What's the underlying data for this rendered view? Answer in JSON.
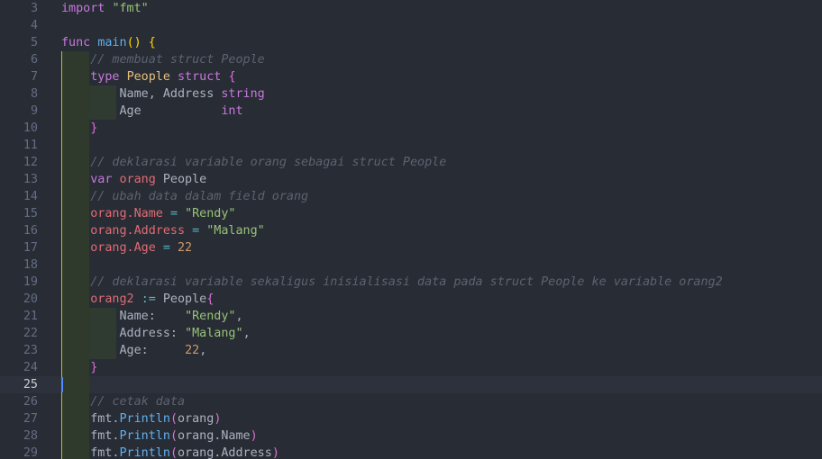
{
  "editor": {
    "current_line": 25,
    "lines": [
      {
        "no": "3",
        "tokens": [
          [
            "kw",
            "import"
          ],
          [
            "pl",
            " "
          ],
          [
            "str",
            "\"fmt\""
          ]
        ]
      },
      {
        "no": "4",
        "tokens": []
      },
      {
        "no": "5",
        "tokens": [
          [
            "kw",
            "func"
          ],
          [
            "pl",
            " "
          ],
          [
            "fn",
            "main"
          ],
          [
            "br1",
            "()"
          ],
          [
            "pl",
            " "
          ],
          [
            "br1",
            "{"
          ]
        ]
      },
      {
        "no": "6",
        "tokens": [
          [
            "cmt",
            "// membuat struct People"
          ]
        ]
      },
      {
        "no": "7",
        "tokens": [
          [
            "kw",
            "type"
          ],
          [
            "pl",
            " "
          ],
          [
            "typ",
            "People"
          ],
          [
            "pl",
            " "
          ],
          [
            "kw",
            "struct"
          ],
          [
            "pl",
            " "
          ],
          [
            "br2",
            "{"
          ]
        ]
      },
      {
        "no": "8",
        "tokens": [
          [
            "pl",
            "    Name, Address "
          ],
          [
            "kw",
            "string"
          ]
        ]
      },
      {
        "no": "9",
        "tokens": [
          [
            "pl",
            "    Age           "
          ],
          [
            "kw",
            "int"
          ]
        ]
      },
      {
        "no": "10",
        "tokens": [
          [
            "br2",
            "}"
          ]
        ]
      },
      {
        "no": "11",
        "tokens": []
      },
      {
        "no": "12",
        "tokens": [
          [
            "cmt",
            "// deklarasi variable orang sebagai struct People"
          ]
        ]
      },
      {
        "no": "13",
        "tokens": [
          [
            "kw",
            "var"
          ],
          [
            "pl",
            " "
          ],
          [
            "var",
            "orang"
          ],
          [
            "pl",
            " People"
          ]
        ]
      },
      {
        "no": "14",
        "tokens": [
          [
            "cmt",
            "// ubah data dalam field orang"
          ]
        ]
      },
      {
        "no": "15",
        "tokens": [
          [
            "var",
            "orang.Name"
          ],
          [
            "pl",
            " "
          ],
          [
            "op",
            "="
          ],
          [
            "pl",
            " "
          ],
          [
            "str",
            "\"Rendy\""
          ]
        ]
      },
      {
        "no": "16",
        "tokens": [
          [
            "var",
            "orang.Address"
          ],
          [
            "pl",
            " "
          ],
          [
            "op",
            "="
          ],
          [
            "pl",
            " "
          ],
          [
            "str",
            "\"Malang\""
          ]
        ]
      },
      {
        "no": "17",
        "tokens": [
          [
            "var",
            "orang.Age"
          ],
          [
            "pl",
            " "
          ],
          [
            "op",
            "="
          ],
          [
            "pl",
            " "
          ],
          [
            "num",
            "22"
          ]
        ]
      },
      {
        "no": "18",
        "tokens": []
      },
      {
        "no": "19",
        "tokens": [
          [
            "cmt",
            "// deklarasi variable sekaligus inisialisasi data pada struct People ke variable orang2"
          ]
        ]
      },
      {
        "no": "20",
        "tokens": [
          [
            "var",
            "orang2"
          ],
          [
            "pl",
            " "
          ],
          [
            "op",
            ":="
          ],
          [
            "pl",
            " People"
          ],
          [
            "br2",
            "{"
          ]
        ]
      },
      {
        "no": "21",
        "tokens": [
          [
            "pl",
            "    Name:    "
          ],
          [
            "str",
            "\"Rendy\""
          ],
          [
            "pl",
            ","
          ]
        ]
      },
      {
        "no": "22",
        "tokens": [
          [
            "pl",
            "    Address: "
          ],
          [
            "str",
            "\"Malang\""
          ],
          [
            "pl",
            ","
          ]
        ]
      },
      {
        "no": "23",
        "tokens": [
          [
            "pl",
            "    Age:     "
          ],
          [
            "num",
            "22"
          ],
          [
            "pl",
            ","
          ]
        ]
      },
      {
        "no": "24",
        "tokens": [
          [
            "br2",
            "}"
          ]
        ]
      },
      {
        "no": "25",
        "tokens": []
      },
      {
        "no": "26",
        "tokens": [
          [
            "cmt",
            "// cetak data"
          ]
        ]
      },
      {
        "no": "27",
        "tokens": [
          [
            "pl",
            "fmt."
          ],
          [
            "fn",
            "Println"
          ],
          [
            "br2",
            "("
          ],
          [
            "pl",
            "orang"
          ],
          [
            "br2",
            ")"
          ]
        ]
      },
      {
        "no": "28",
        "tokens": [
          [
            "pl",
            "fmt."
          ],
          [
            "fn",
            "Println"
          ],
          [
            "br2",
            "("
          ],
          [
            "pl",
            "orang.Name"
          ],
          [
            "br2",
            ")"
          ]
        ]
      },
      {
        "no": "29",
        "tokens": [
          [
            "pl",
            "fmt."
          ],
          [
            "fn",
            "Println"
          ],
          [
            "br2",
            "("
          ],
          [
            "pl",
            "orang.Address"
          ],
          [
            "br2",
            ")"
          ]
        ]
      }
    ]
  },
  "colors": {
    "background": "#282c34",
    "keyword": "#c678dd",
    "function": "#61afef",
    "string": "#98c379",
    "variable": "#e06c75",
    "number": "#d19a66",
    "type": "#e5c07b",
    "comment": "#5c6370",
    "caret": "#528bff"
  }
}
